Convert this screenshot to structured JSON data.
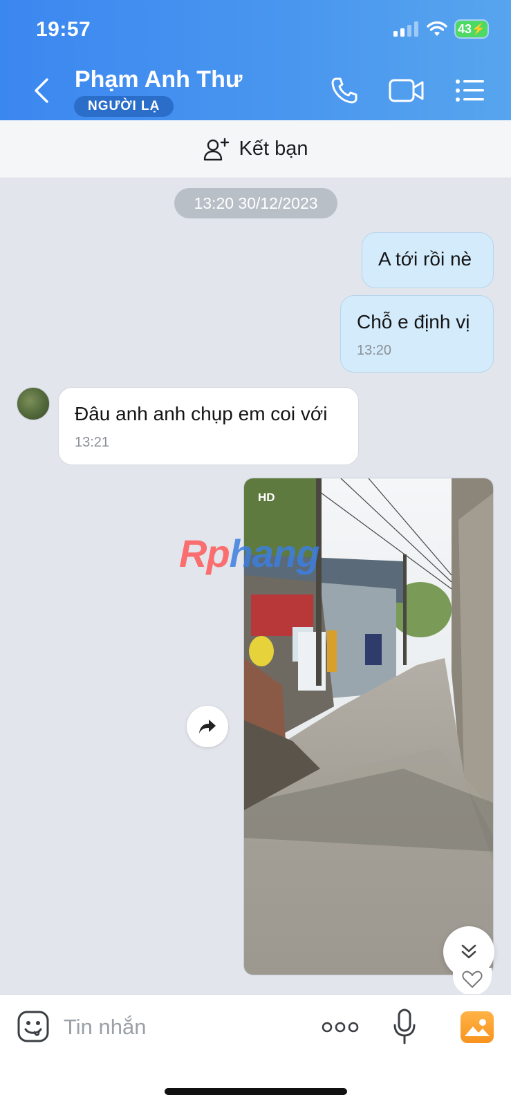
{
  "status_bar": {
    "time": "19:57",
    "battery": "43"
  },
  "header": {
    "contact_name": "Phạm Anh Thư",
    "badge": "NGƯỜI LẠ",
    "icons": [
      "back-icon",
      "phone-icon",
      "video-call-icon",
      "menu-list-icon"
    ]
  },
  "friend_bar": {
    "label": "Kết bạn",
    "icon": "add-friend-icon"
  },
  "chat": {
    "date_separator": "13:20 30/12/2023",
    "messages": [
      {
        "direction": "out",
        "text": "A tới rồi nè",
        "time": ""
      },
      {
        "direction": "out",
        "text": "Chỗ e định vị",
        "time": "13:20"
      },
      {
        "direction": "in",
        "text": "Đâu anh anh chụp em coi với",
        "time": "13:21"
      },
      {
        "direction": "out",
        "type": "photo",
        "badge": "HD"
      }
    ],
    "watermark": {
      "part1": "Rp",
      "part2": "hang"
    }
  },
  "composer": {
    "placeholder": "Tin nhắn",
    "icons": [
      "emoji-icon",
      "more-icon",
      "mic-icon",
      "gallery-icon"
    ]
  },
  "colors": {
    "header_start": "#3b87f0",
    "header_end": "#57a5ee",
    "outgoing_bubble": "#d4ebfb",
    "incoming_bubble": "#ffffff",
    "chat_bg": "#e2e6ec",
    "badge_bg": "#2a6ec9"
  }
}
